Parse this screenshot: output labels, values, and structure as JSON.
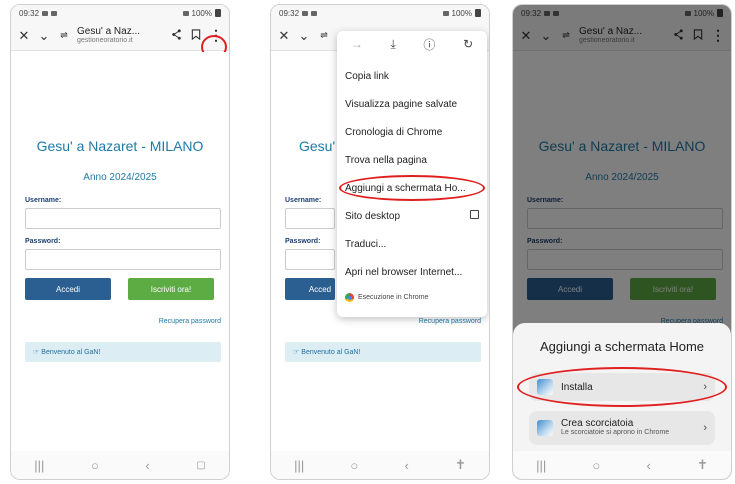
{
  "status": {
    "time": "09:32",
    "battery": "100%"
  },
  "toolbar": {
    "title": "Gesu' a Naz...",
    "domain": "gestioneoratorio.it"
  },
  "site": {
    "title": "Gesu' a Nazaret - MILANO",
    "year": "Anno 2024/2025",
    "username_label": "Username:",
    "password_label": "Password:",
    "login_button": "Accedi",
    "signup_button": "Iscriviti ora!",
    "recover_link": "Recupera password",
    "welcome": "Benvenuto al GaN!"
  },
  "menu": {
    "items": [
      "Copia link",
      "Visualizza pagine salvate",
      "Cronologia di Chrome",
      "Trova nella pagina",
      "Aggiungi a schermata Ho...",
      "Sito desktop",
      "Traduci...",
      "Apri nel browser Internet..."
    ],
    "footer": "Esecuzione in Chrome"
  },
  "sheet": {
    "title": "Aggiungi a schermata Home",
    "install": "Installa",
    "shortcut": "Crea scorciatoia",
    "shortcut_sub": "Le scorciatoie si aprono in Chrome"
  },
  "icons": {
    "close": "close-icon",
    "chevron": "chevron-down-icon",
    "tabs": "tabs-icon",
    "share": "share-icon",
    "bookmark": "bookmark-icon",
    "menu": "more-vert-icon"
  },
  "colors": {
    "title_blue": "#1e7aa8",
    "login_blue": "#2b5f91",
    "signup_green": "#5cab43",
    "highlight_red": "#e02020"
  }
}
